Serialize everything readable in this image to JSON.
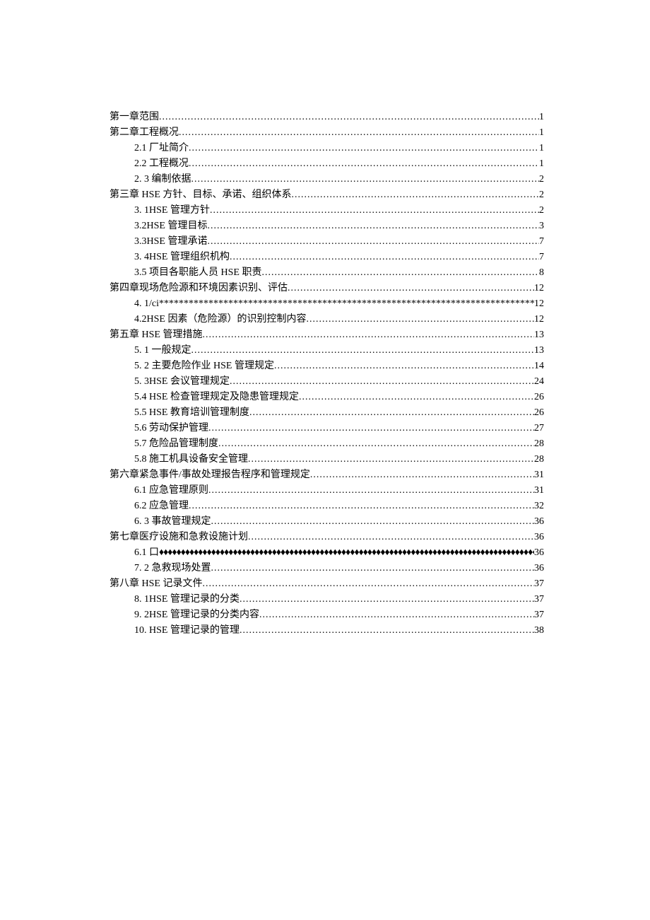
{
  "toc": [
    {
      "level": 1,
      "label": "第一章范围",
      "page": "1",
      "fill": "normal"
    },
    {
      "level": 1,
      "label": "第二章工程概况",
      "page": "1",
      "fill": "normal"
    },
    {
      "level": 2,
      "label": "2.1 厂址简介",
      "page": "1",
      "fill": "normal"
    },
    {
      "level": 2,
      "label": "2.2 工程概况",
      "page": "1",
      "fill": "normal"
    },
    {
      "level": 2,
      "label": "2.  3 编制依据",
      "page": "2",
      "fill": "normal"
    },
    {
      "level": 1,
      "label": "第三章 HSE 方针、目标、承诺、组织体系",
      "page": "2",
      "fill": "normal"
    },
    {
      "level": 2,
      "label": "3.  1HSE 管理方针",
      "page": "2",
      "fill": "normal"
    },
    {
      "level": 2,
      "label": "3.2HSE 管理目标",
      "page": "3",
      "fill": "normal"
    },
    {
      "level": 2,
      "label": "3.3HSE 管理承诺",
      "page": "7",
      "fill": "normal"
    },
    {
      "level": 2,
      "label": "3.  4HSE 管理组织机构",
      "page": "7",
      "fill": "normal"
    },
    {
      "level": 2,
      "label": "3.5 项目各职能人员 HSE 职责",
      "page": "8",
      "fill": "normal"
    },
    {
      "level": 1,
      "label": "第四章现场危险源和环境因素识别、评估",
      "page": "12",
      "fill": "normal"
    },
    {
      "level": 2,
      "label": "4.  1/ci",
      "page": "12",
      "fill": "stars"
    },
    {
      "level": 2,
      "label": "4.2HSE 因素（危险源）的识别控制内容",
      "page": "12",
      "fill": "normal"
    },
    {
      "level": 1,
      "label": "第五章 HSE 管理措施",
      "page": "13",
      "fill": "normal"
    },
    {
      "level": 2,
      "label": "5.  1 一般规定",
      "page": "13",
      "fill": "normal"
    },
    {
      "level": 2,
      "label": "5.  2 主要危险作业 HSE 管理规定",
      "page": "14",
      "fill": "normal"
    },
    {
      "level": 2,
      "label": "5.  3HSE 会议管理规定",
      "page": "24",
      "fill": "normal"
    },
    {
      "level": 2,
      "label": "5.4    HSE 检查管理规定及隐患管理规定",
      "page": "26",
      "fill": "normal"
    },
    {
      "level": 2,
      "label": "5.5    HSE 教育培训管理制度",
      "page": "26",
      "fill": "normal"
    },
    {
      "level": 2,
      "label": "5.6 劳动保护管理",
      "page": "27",
      "fill": "normal"
    },
    {
      "level": 2,
      "label": "5.7 危险品管理制度",
      "page": "28",
      "fill": "normal"
    },
    {
      "level": 2,
      "label": "5.8 施工机具设备安全管理",
      "page": "28",
      "fill": "normal"
    },
    {
      "level": 1,
      "label": "第六章紧急事件/事故处理报告程序和管理规定",
      "page": "31",
      "fill": "normal"
    },
    {
      "level": 2,
      "label": "6.1 应急管理原则",
      "page": "31",
      "fill": "normal"
    },
    {
      "level": 2,
      "label": "6.2 应急管理",
      "page": "32",
      "fill": "normal"
    },
    {
      "level": 2,
      "label": "6.  3 事故管理规定",
      "page": "36",
      "fill": "normal"
    },
    {
      "level": 1,
      "label": "第七章医疗设施和急救设施计划",
      "page": "36",
      "fill": "normal"
    },
    {
      "level": 2,
      "label": "6.1          口",
      "page": "36",
      "fill": "diamonds"
    },
    {
      "level": 2,
      "label": "7.  2 急救现场处置",
      "page": "36",
      "fill": "normal"
    },
    {
      "level": 1,
      "label": "第八章 HSE 记录文件",
      "page": "37",
      "fill": "normal"
    },
    {
      "level": 2,
      "label": "8.  1HSE 管理记录的分类",
      "page": "37",
      "fill": "normal"
    },
    {
      "level": 2,
      "label": "9.  2HSE 管理记录的分类内容",
      "page": "37",
      "fill": "normal"
    },
    {
      "level": 2,
      "label": "10.    HSE 管理记录的管理",
      "page": "38",
      "fill": "normal"
    }
  ]
}
